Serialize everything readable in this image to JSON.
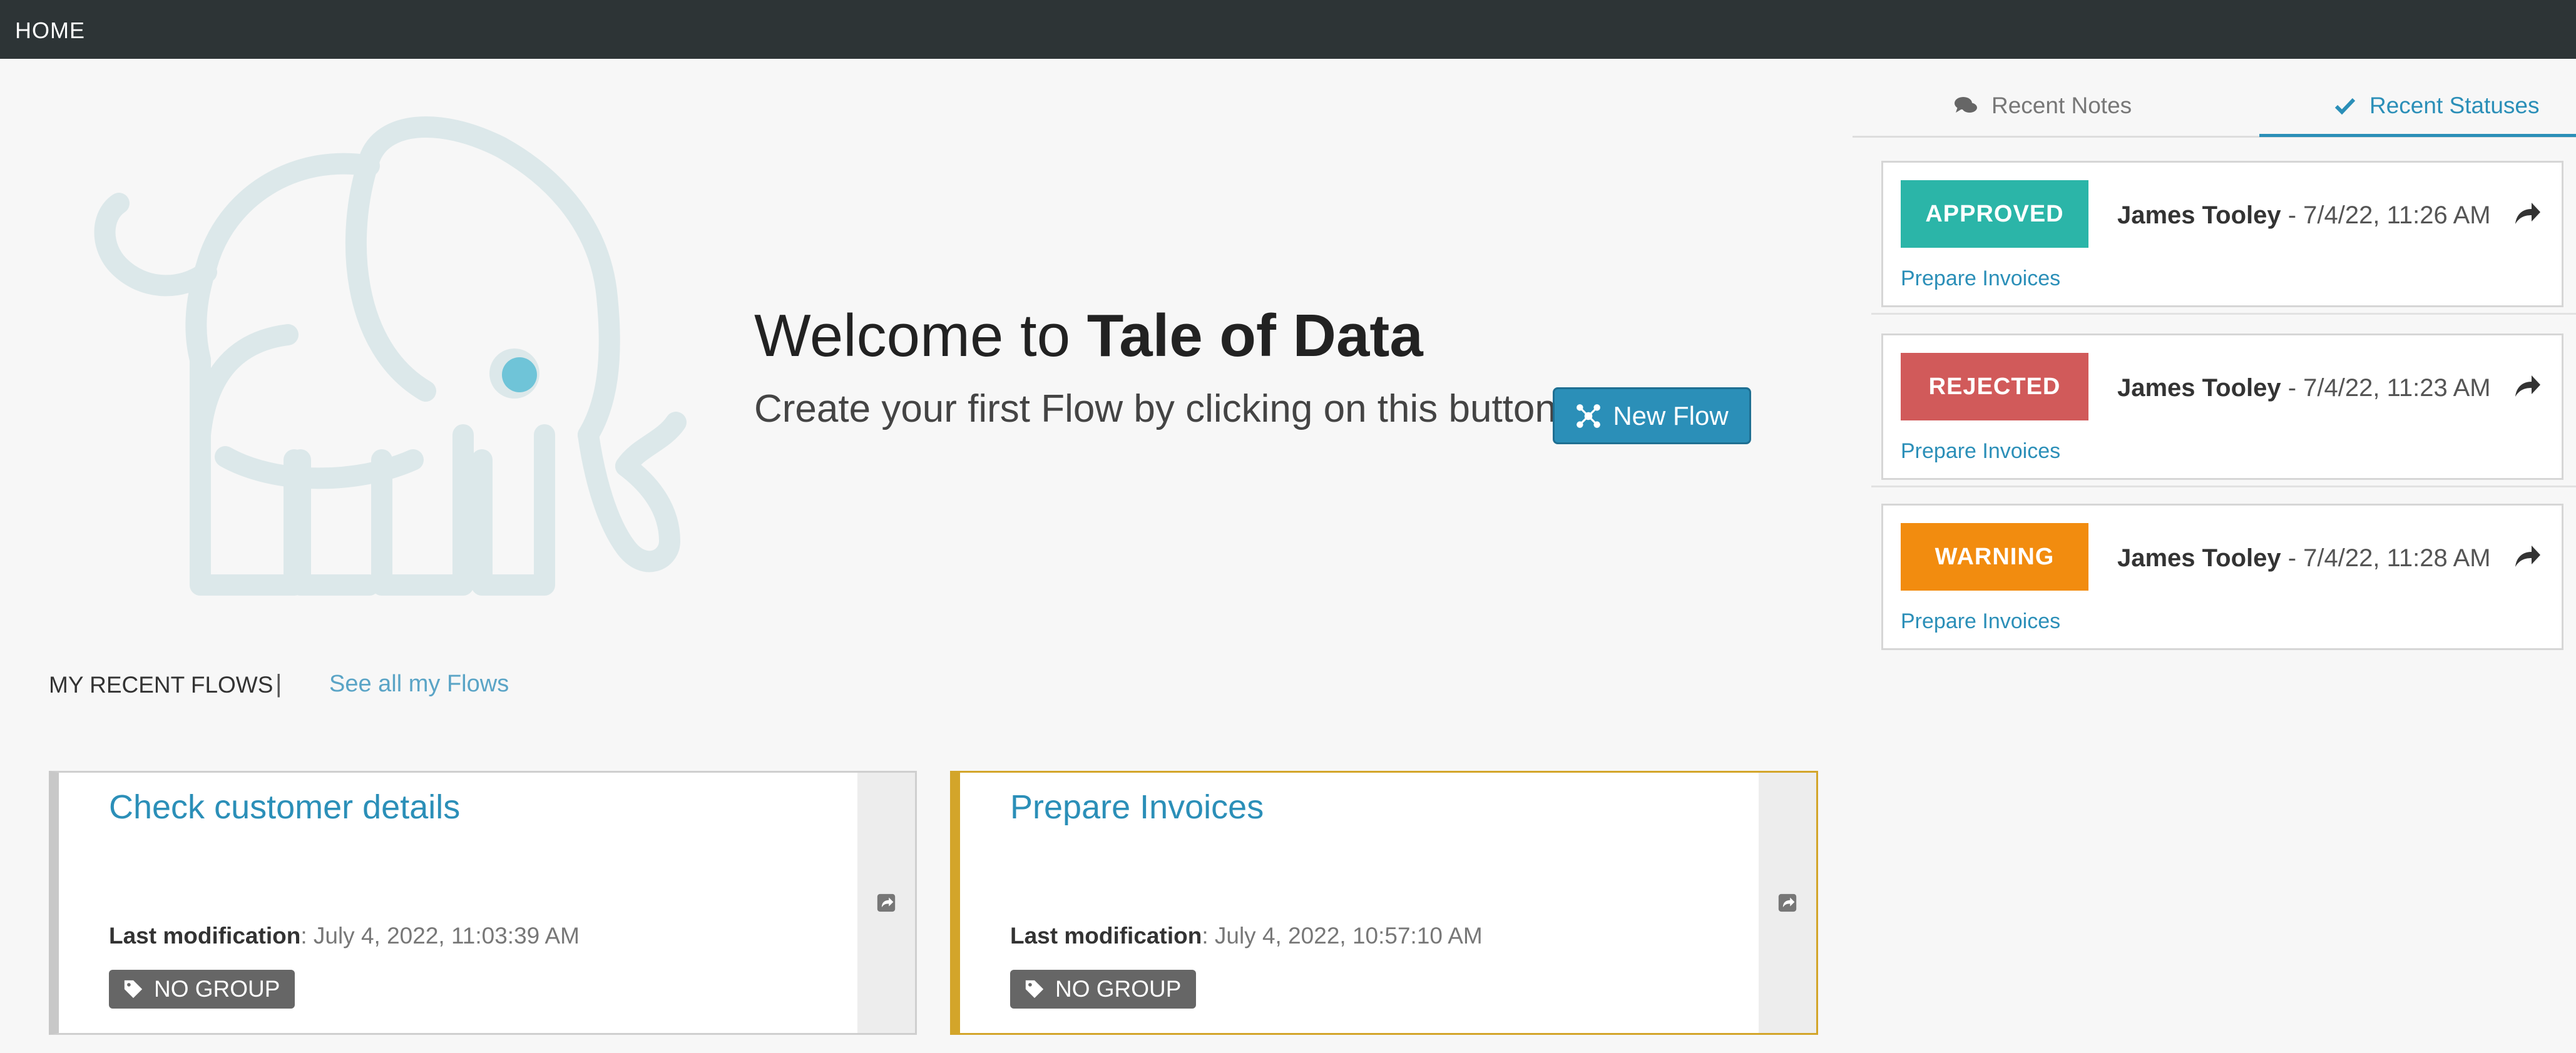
{
  "topbar": {
    "home_label": "HOME"
  },
  "welcome": {
    "title_prefix": "Welcome to ",
    "title_brand": "Tale of Data",
    "subtitle": "Create your first Flow by clicking on this button",
    "new_flow_label": "New Flow"
  },
  "recent": {
    "header": "MY RECENT FLOWS",
    "separator": "|",
    "see_all": "See all my Flows"
  },
  "flows": [
    {
      "title": "Check customer details",
      "mod_label": "Last modification",
      "mod_value": ": July 4, 2022, 11:03:39 AM",
      "group": "NO GROUP"
    },
    {
      "title": "Prepare Invoices",
      "mod_label": "Last modification",
      "mod_value": ": July 4, 2022, 10:57:10 AM",
      "group": "NO GROUP"
    }
  ],
  "panel": {
    "tabs": [
      {
        "label": "Recent Notes",
        "icon": "comments-icon"
      },
      {
        "label": "Recent Statuses",
        "icon": "check-icon",
        "active": true
      }
    ],
    "statuses": [
      {
        "badge": "APPROVED",
        "color": "#2bb5a8",
        "user": "James Tooley",
        "time": " - 7/4/22, 11:26 AM",
        "flow": "Prepare Invoices"
      },
      {
        "badge": "REJECTED",
        "color": "#d15a5a",
        "user": "James Tooley",
        "time": " - 7/4/22, 11:23 AM",
        "flow": "Prepare Invoices"
      },
      {
        "badge": "WARNING",
        "color": "#f28c0f",
        "user": "James Tooley",
        "time": " - 7/4/22, 11:28 AM",
        "flow": "Prepare Invoices"
      }
    ]
  },
  "colors": {
    "accent": "#2b8fb8",
    "topbar": "#2d3436",
    "elephant": "#dce8ea",
    "elephant_eye": "#6fc4d8",
    "card_highlight": "#d3a52a"
  }
}
